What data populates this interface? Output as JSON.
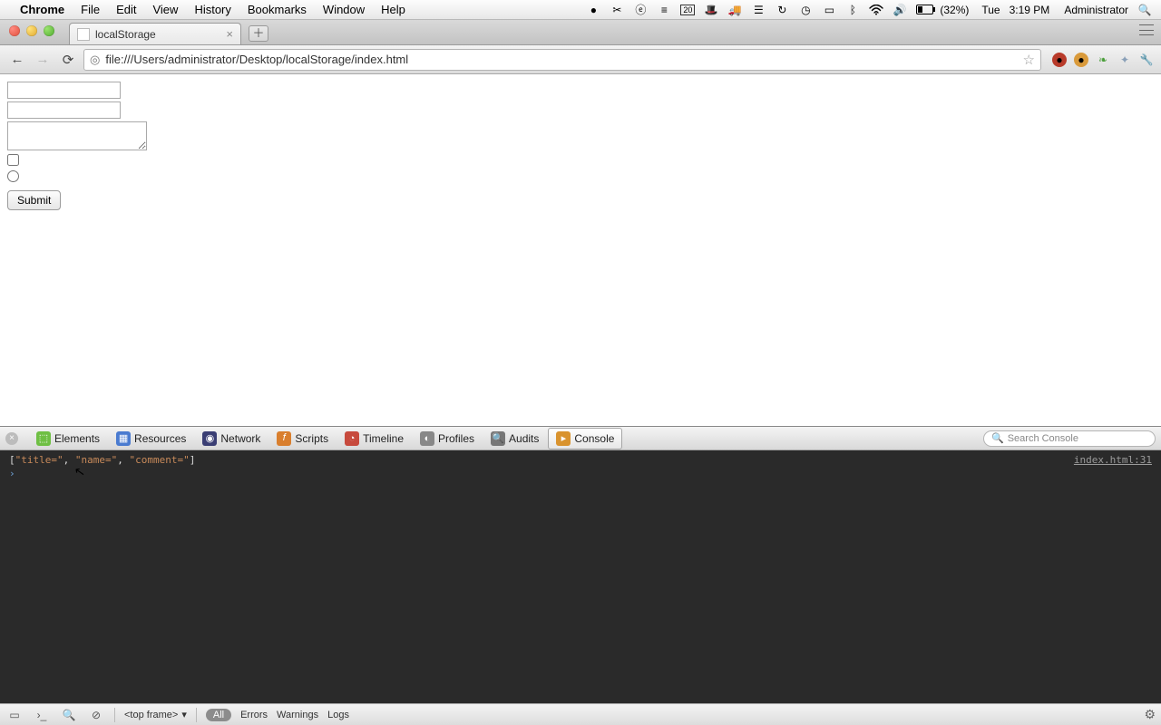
{
  "menubar": {
    "app_name": "Chrome",
    "items": [
      "File",
      "Edit",
      "View",
      "History",
      "Bookmarks",
      "Window",
      "Help"
    ],
    "battery": "(32%)",
    "day": "Tue",
    "time": "3:19 PM",
    "user": "Administrator"
  },
  "browser": {
    "tab_title": "localStorage",
    "url": "file:///Users/administrator/Desktop/localStorage/index.html"
  },
  "page": {
    "input1_value": "",
    "input2_value": "",
    "textarea_value": "",
    "checkbox_checked": false,
    "radio_checked": false,
    "submit_label": "Submit"
  },
  "devtools": {
    "tabs": [
      "Elements",
      "Resources",
      "Network",
      "Scripts",
      "Timeline",
      "Profiles",
      "Audits",
      "Console"
    ],
    "active_tab": "Console",
    "search_placeholder": "Search Console",
    "log_output": "[\"title=\", \"name=\", \"comment=\"]",
    "log_source": "index.html:31",
    "frame_selector": "<top frame>",
    "filter_all": "All",
    "filters": [
      "Errors",
      "Warnings",
      "Logs"
    ]
  }
}
